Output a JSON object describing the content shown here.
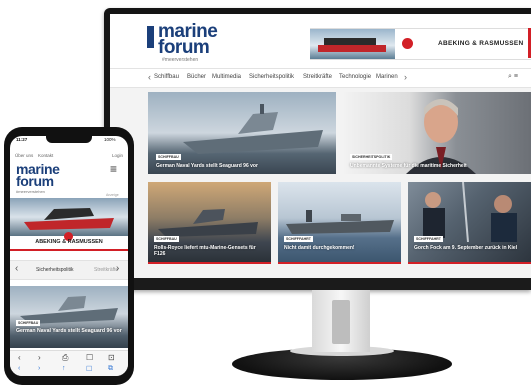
{
  "desktop": {
    "logo_line1": "marine",
    "logo_line2": "forum",
    "logo_tag": "#meerverstehen",
    "ad_text": "ABEKING & RASMUSSEN",
    "nav_items": [
      "Schiffbau",
      "Bücher",
      "Multimedia",
      "Sicherheitspolitik",
      "Streitkräfte",
      "Technologie",
      "Marinen"
    ],
    "nav_prev": "‹",
    "nav_next": "›",
    "nav_icons": "⌕ ≡",
    "articles": [
      {
        "badge": "SCHIFFBAU",
        "title": "German Naval Yards stellt Seaguard 96 vor"
      },
      {
        "badge": "SICHERHEITSPOLITIK",
        "title": "Unbemannte Systeme für die maritime Sicherheit"
      },
      {
        "badge": "SCHIFFBAU",
        "title": "Rolls-Royce liefert mtu-Marine-Gensets für F126"
      },
      {
        "badge": "SCHIFFFAHRT",
        "title": "Nicht damit durchgekommen!"
      },
      {
        "badge": "SCHIFFFAHRT",
        "title": "Gorch Fock am 9. September zurück in Kiel"
      }
    ]
  },
  "phone": {
    "status_time": "11:27",
    "status_battery": "100%",
    "top_links": [
      "Über uns",
      "Kontakt"
    ],
    "login": "Login",
    "logo_line1": "marine",
    "logo_line2": "forum",
    "logo_tag": "#meerverstehen",
    "menu_icon": "≡",
    "ad_label": "Anzeige",
    "ad_text": "ABEKING & RASMUSSEN",
    "nav_prev": "‹",
    "nav_next": "›",
    "nav_item1": "Sicherheitspolitik",
    "nav_item2": "Streitkräfte",
    "badge": "SCHIFFBAU",
    "title": "German Naval Yards stellt Seaguard 96 vor",
    "browser_bar": [
      "‹",
      "›",
      "⎙",
      "☐",
      "⊡"
    ],
    "toolbar": [
      "‹",
      "›",
      "↑",
      "☐",
      "⧉"
    ]
  }
}
